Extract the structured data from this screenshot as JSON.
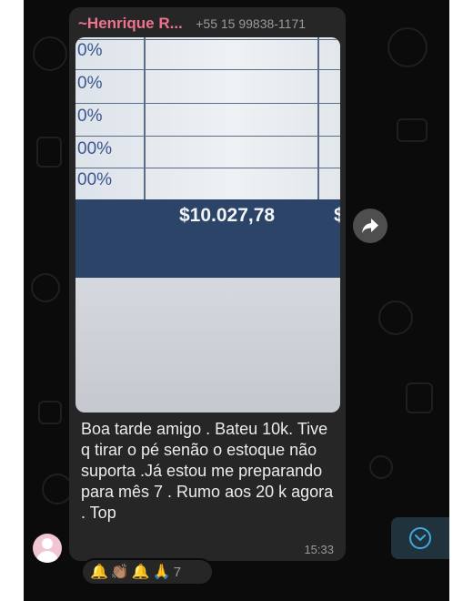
{
  "message": {
    "sender_name": "~Henrique R...",
    "sender_phone": "+55 15 99838-1171",
    "text": "Boa tarde amigo . Bateu 10k. Tive q tirar o pé senão o estoque não suporta .Já estou me preparando para mês 7 . Rumo aos 20 k agora . Top",
    "time": "15:33",
    "photo": {
      "percent_cells": [
        "0%",
        "0%",
        "0%",
        "00%",
        "00%"
      ],
      "amount": "$10.027,78",
      "amount_partial": "$"
    },
    "reactions": {
      "emojis": [
        "🔔",
        "👏🏽",
        "🔔",
        "🙏"
      ],
      "count": "7"
    }
  },
  "icons": {
    "forward": "forward-arrow-icon",
    "scroll_down": "chevron-down-icon",
    "avatar": "default-avatar-icon"
  },
  "colors": {
    "sender_name": "#f0728f",
    "bubble": "#262626",
    "chat_background": "#0b0b0b",
    "scroll_accent": "#3fa9e0"
  }
}
